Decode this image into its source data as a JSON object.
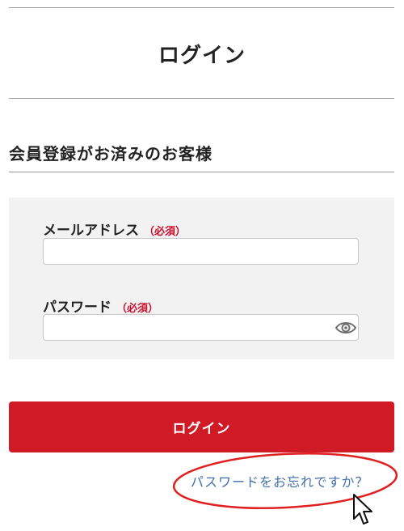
{
  "header": {
    "title": "ログイン"
  },
  "section": {
    "title": "会員登録がお済みのお客様"
  },
  "form": {
    "email": {
      "label": "メールアドレス",
      "required": "（必須）",
      "value": "",
      "placeholder": ""
    },
    "password": {
      "label": "パスワード",
      "required": "（必須）",
      "value": "",
      "placeholder": "",
      "toggle_icon": "eye-icon"
    },
    "submit_label": "ログイン",
    "forgot_label": "パスワードをお忘れですか？"
  },
  "colors": {
    "accent": "#d01a26",
    "required": "#c8102e",
    "link": "#3f6fa8",
    "panel": "#f2f2f2",
    "annotation": "#e02020"
  },
  "annotations": {
    "highlight": "red-ellipse",
    "cursor": "cursor-arrow-icon"
  }
}
